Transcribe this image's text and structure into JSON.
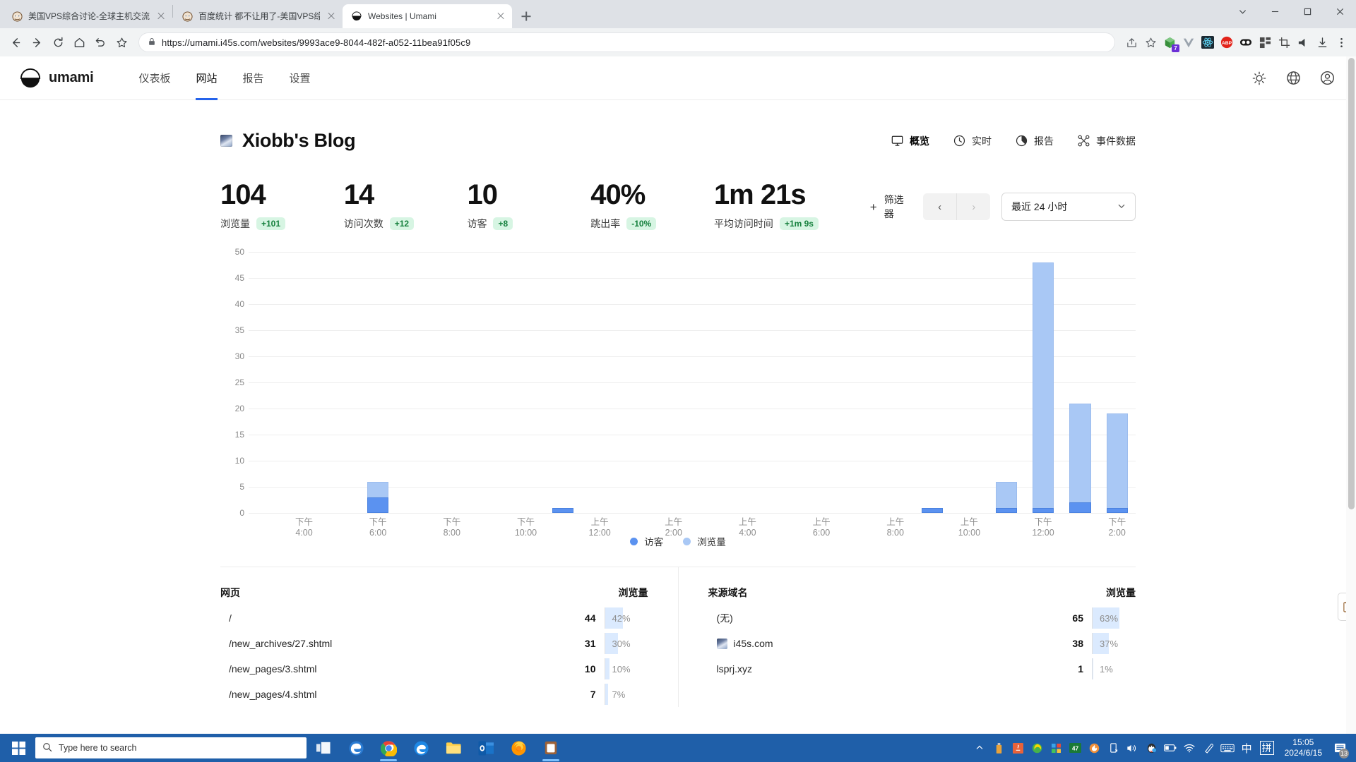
{
  "browser": {
    "tabs": [
      {
        "title": "美国VPS综合讨论-全球主机交流",
        "favicon": "forum-icon",
        "active": false
      },
      {
        "title": "百度统计 都不让用了-美国VPS综",
        "favicon": "forum-icon",
        "active": false
      },
      {
        "title": "Websites | Umami",
        "favicon": "umami-icon",
        "active": true
      }
    ],
    "newtab_label": "+",
    "url": "https://umami.i45s.com/websites/9993ace9-8044-482f-a052-11bea91f05c9",
    "nav": {
      "back": "back-icon",
      "forward": "forward-icon",
      "reload": "reload-icon",
      "home": "home-icon",
      "history_back": "undo-icon",
      "bookmark": "star-icon"
    },
    "extensions": [
      {
        "name": "share-icon"
      },
      {
        "name": "bookmark-star-icon"
      },
      {
        "name": "green-cube-extension",
        "badge": "7"
      },
      {
        "name": "vue-devtools-extension"
      },
      {
        "name": "react-devtools-extension"
      },
      {
        "name": "adblock-plus-extension"
      },
      {
        "name": "dark-reader-extension"
      },
      {
        "name": "apps-grid-extension"
      },
      {
        "name": "screenshot-crop-extension"
      },
      {
        "name": "speaker-extension"
      },
      {
        "name": "download-icon"
      },
      {
        "name": "chrome-menu-icon"
      }
    ],
    "window_controls": [
      "minimize",
      "maximize",
      "close",
      "chevron-down"
    ]
  },
  "app": {
    "brand": "umami",
    "nav_items": [
      {
        "label": "仪表板",
        "active": false
      },
      {
        "label": "网站",
        "active": true
      },
      {
        "label": "报告",
        "active": false
      },
      {
        "label": "设置",
        "active": false
      }
    ],
    "nav_right": [
      "theme-toggle-icon",
      "language-icon",
      "profile-icon"
    ]
  },
  "site": {
    "name": "Xiobb's Blog",
    "view_tabs": [
      {
        "label": "概览",
        "icon": "monitor-icon",
        "active": true
      },
      {
        "label": "实时",
        "icon": "clock-icon",
        "active": false
      },
      {
        "label": "报告",
        "icon": "pie-chart-icon",
        "active": false
      },
      {
        "label": "事件数据",
        "icon": "nodes-icon",
        "active": false
      }
    ]
  },
  "metrics": [
    {
      "value": "104",
      "label": "浏览量",
      "delta": "+101",
      "positive": true
    },
    {
      "value": "14",
      "label": "访问次数",
      "delta": "+12",
      "positive": true
    },
    {
      "value": "10",
      "label": "访客",
      "delta": "+8",
      "positive": true
    },
    {
      "value": "40%",
      "label": "跳出率",
      "delta": "-10%",
      "positive": true
    },
    {
      "value": "1m 21s",
      "label": "平均访问时间",
      "delta": "+1m 9s",
      "positive": true
    }
  ],
  "controls": {
    "filter_label": "筛选器",
    "filter_plus": "+",
    "prev": "‹",
    "next": "›",
    "date_range": "最近 24 小时",
    "chevron": "▼"
  },
  "chart_data": {
    "type": "bar",
    "title": "",
    "xlabel": "",
    "ylabel": "",
    "ylim": [
      0,
      50
    ],
    "yticks": [
      0,
      5,
      10,
      15,
      20,
      25,
      30,
      35,
      40,
      45,
      50
    ],
    "grid": true,
    "legend_position": "bottom",
    "legend": [
      {
        "name": "访客",
        "color": "#5b92f0"
      },
      {
        "name": "浏览量",
        "color": "#a9c8f5"
      }
    ],
    "tick_labels": [
      "下午 4:00",
      "下午 6:00",
      "下午 8:00",
      "下午 10:00",
      "上午 12:00",
      "上午 2:00",
      "上午 4:00",
      "上午 6:00",
      "上午 8:00",
      "上午 10:00",
      "下午 12:00",
      "下午 2:00"
    ],
    "categories": [
      "15:00",
      "16:00",
      "17:00",
      "18:00",
      "19:00",
      "20:00",
      "21:00",
      "22:00",
      "23:00",
      "00:00",
      "01:00",
      "02:00",
      "03:00",
      "04:00",
      "05:00",
      "06:00",
      "07:00",
      "08:00",
      "09:00",
      "10:00",
      "11:00",
      "12:00",
      "13:00",
      "14:00"
    ],
    "series": [
      {
        "name": "访客",
        "color": "#5b92f0",
        "values": [
          0,
          0,
          0,
          3,
          0,
          0,
          0,
          0,
          1,
          0,
          0,
          0,
          0,
          0,
          0,
          0,
          0,
          0,
          1,
          0,
          1,
          1,
          2,
          1
        ]
      },
      {
        "name": "浏览量",
        "color": "#a9c8f5",
        "values": [
          0,
          0,
          0,
          6,
          0,
          0,
          0,
          0,
          1,
          0,
          0,
          0,
          0,
          0,
          0,
          0,
          0,
          0,
          1,
          0,
          6,
          48,
          21,
          19
        ]
      }
    ]
  },
  "pages_table": {
    "header_label": "网页",
    "header_metric": "浏览量",
    "rows": [
      {
        "label": "/",
        "value": "44",
        "pct": "42%",
        "pct_num": 42,
        "icon": false
      },
      {
        "label": "/new_archives/27.shtml",
        "value": "31",
        "pct": "30%",
        "pct_num": 30,
        "icon": false
      },
      {
        "label": "/new_pages/3.shtml",
        "value": "10",
        "pct": "10%",
        "pct_num": 10,
        "icon": false
      },
      {
        "label": "/new_pages/4.shtml",
        "value": "7",
        "pct": "7%",
        "pct_num": 7,
        "icon": false
      }
    ]
  },
  "referrers_table": {
    "header_label": "来源域名",
    "header_metric": "浏览量",
    "rows": [
      {
        "label": "(无)",
        "value": "65",
        "pct": "63%",
        "pct_num": 63,
        "icon": false
      },
      {
        "label": "i45s.com",
        "value": "38",
        "pct": "37%",
        "pct_num": 37,
        "icon": true
      },
      {
        "label": "lsprj.xyz",
        "value": "1",
        "pct": "1%",
        "pct_num": 1,
        "icon": false
      }
    ]
  },
  "taskbar": {
    "search_placeholder": "Type here to search",
    "apps": [
      "task-view-icon",
      "chrome-icon",
      "edge-legacy-icon",
      "file-explorer-icon",
      "outlook-icon",
      "firefox-icon",
      "clipboard-app-icon"
    ],
    "tray_icons": [
      "chevron-up-icon",
      "usb-icon",
      "java-icon",
      "maxthon-icon",
      "colorful-icon",
      "counter-47-icon",
      "flame-icon",
      "usb-eject-icon",
      "volume-icon",
      "qq-icon",
      "battery-icon",
      "wifi-icon",
      "pen-icon",
      "keyboard-icon",
      "ime-chinese-icon",
      "pinyin-icon"
    ],
    "counter": "47",
    "ime": "中",
    "ime2": "拼",
    "time": "15:05",
    "date": "2024/6/15",
    "notification_count": "13"
  },
  "colors": {
    "accent": "#2563eb",
    "bar_visitors": "#5b92f0",
    "bar_pageviews": "#a9c8f5",
    "delta_bg": "#d7f5e3",
    "delta_fg": "#15803d",
    "taskbar": "#1f5fa9"
  }
}
